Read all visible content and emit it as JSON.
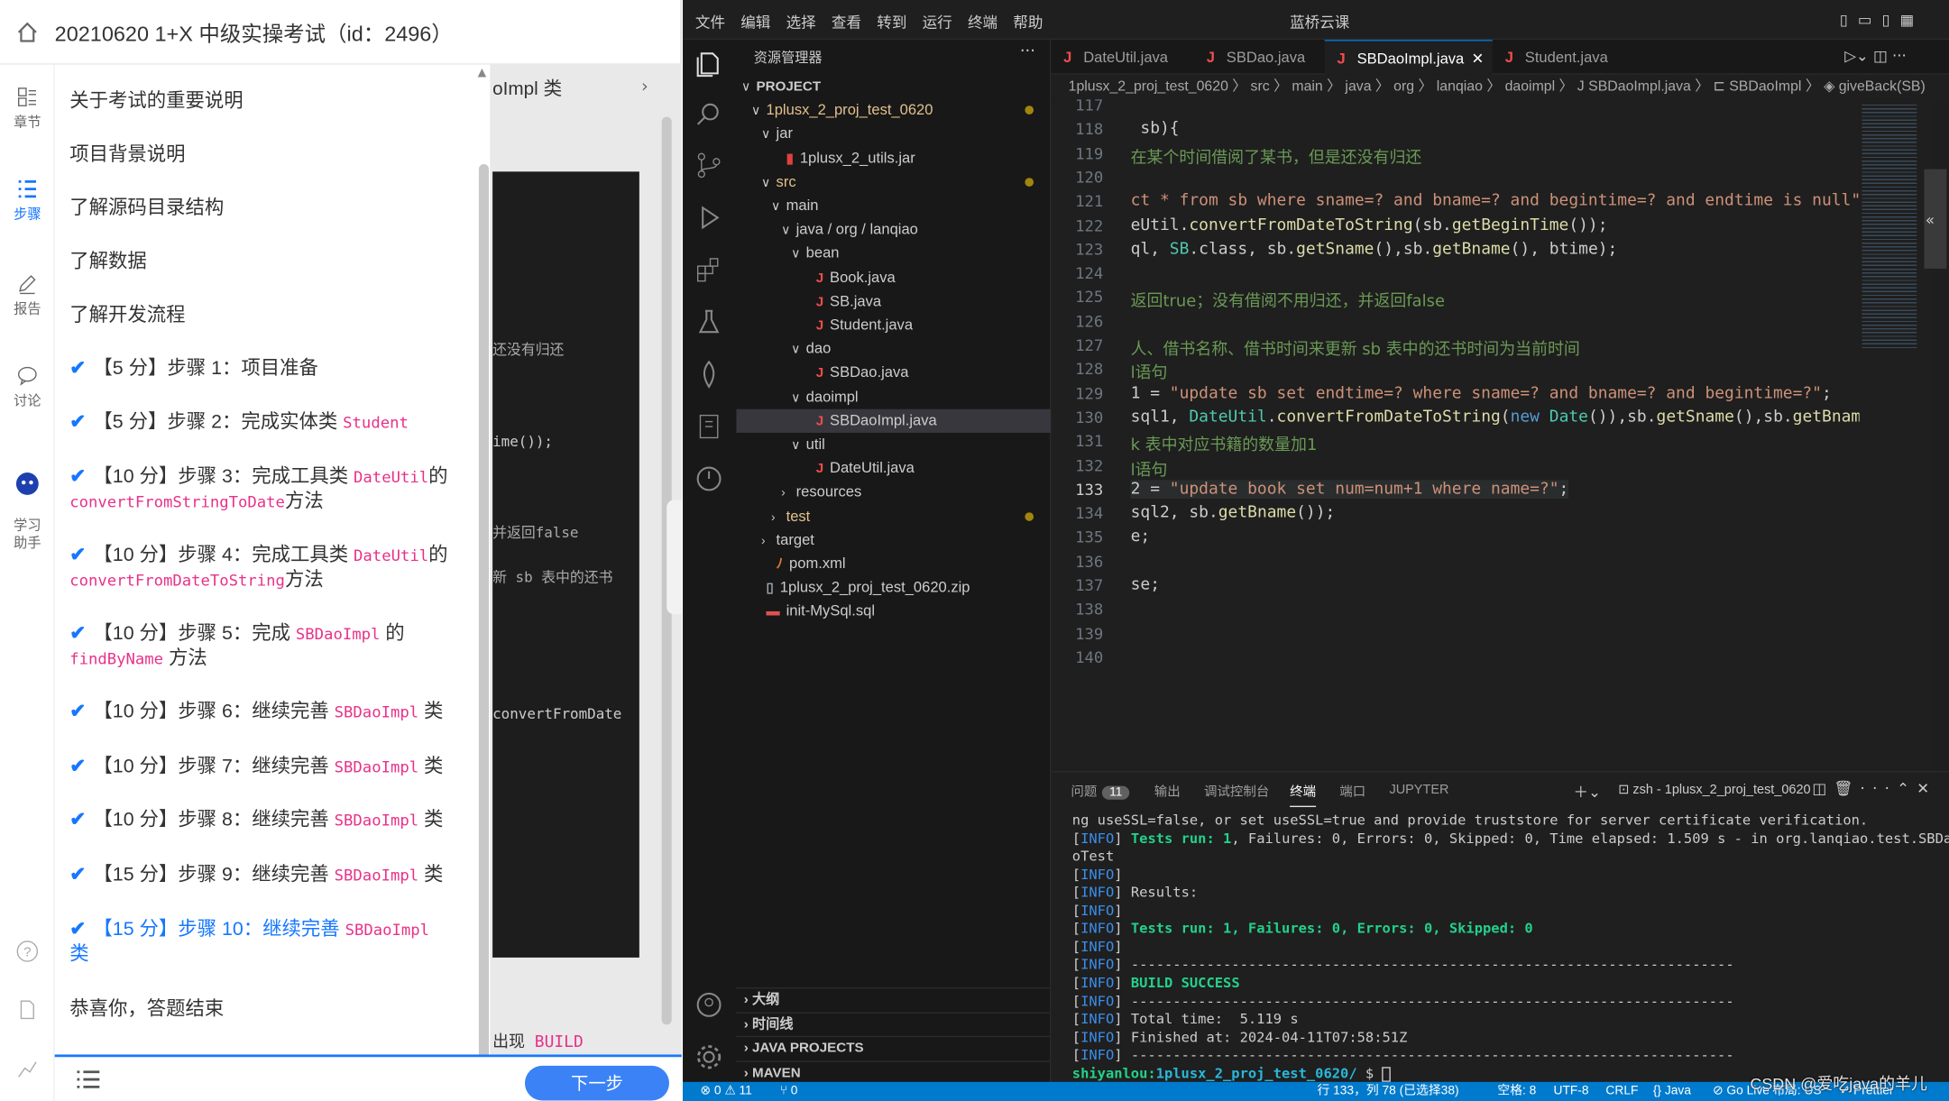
{
  "exam": {
    "title": "20210620 1+X 中级实操考试（id：2496）",
    "rail": [
      "章节",
      "步骤",
      "报告",
      "讨论",
      "学习\n助手"
    ],
    "steps": [
      {
        "text": "关于考试的重要说明"
      },
      {
        "text": "项目背景说明"
      },
      {
        "text": "了解源码目录结构"
      },
      {
        "text": "了解数据"
      },
      {
        "text": "了解开发流程"
      },
      {
        "pre": "【5 分】步骤 1：项目准备",
        "code": "",
        "post": "",
        "done": true
      },
      {
        "pre": "【5 分】步骤 2：完成实体类 ",
        "code": "Student",
        "post": "",
        "done": true
      },
      {
        "pre": "【10 分】步骤 3：完成工具类 ",
        "code": "DateUtil",
        "post": "的",
        "line2code": "convertFromStringToDate",
        "line2post": "方法",
        "done": true
      },
      {
        "pre": "【10 分】步骤 4：完成工具类 ",
        "code": "DateUtil",
        "post": "的",
        "line2code": "convertFromDateToString",
        "line2post": "方法",
        "done": true
      },
      {
        "pre": "【10 分】步骤 5：完成 ",
        "code": "SBDaoImpl",
        "post": " 的",
        "line2code": "findByName",
        "line2post": " 方法",
        "done": true
      },
      {
        "pre": "【10 分】步骤 6：继续完善 ",
        "code": "SBDaoImpl",
        "post": " 类",
        "done": true
      },
      {
        "pre": "【10 分】步骤 7：继续完善 ",
        "code": "SBDaoImpl",
        "post": " 类",
        "done": true
      },
      {
        "pre": "【10 分】步骤 8：继续完善 ",
        "code": "SBDaoImpl",
        "post": " 类",
        "done": true
      },
      {
        "pre": "【15 分】步骤 9：继续完善 ",
        "code": "SBDaoImpl",
        "post": " 类",
        "done": true
      },
      {
        "pre": "【15 分】步骤 10：继续完善 ",
        "code": "SBDaoImpl",
        "post": "",
        "line2post": "类",
        "done": true,
        "current": true
      },
      {
        "text": "恭喜你，答题结束"
      }
    ],
    "under_texts": [
      "oImpl 类",
      "还没有归还",
      "ime());",
      "并返回false",
      "新 sb 表中的还书",
      "convertFromDate",
      "出现 ",
      "BUILD"
    ],
    "next_button": "下一步"
  },
  "vscode": {
    "menu": [
      "文件",
      "编辑",
      "选择",
      "查看",
      "转到",
      "运行",
      "终端",
      "帮助"
    ],
    "window_title": "蓝桥云课",
    "explorer_title": "资源管理器",
    "tree": [
      {
        "label": "PROJECT",
        "depth": 0,
        "chev": "∨",
        "bold": true
      },
      {
        "label": "1plusx_2_proj_test_0620",
        "depth": 1,
        "chev": "∨",
        "mod": true,
        "color": "#e2c08d"
      },
      {
        "label": "jar",
        "depth": 2,
        "chev": "∨"
      },
      {
        "label": "1plusx_2_utils.jar",
        "depth": 3,
        "icon": "jar"
      },
      {
        "label": "src",
        "depth": 2,
        "chev": "∨",
        "mod": true,
        "color": "#e2c08d"
      },
      {
        "label": "main",
        "depth": 3,
        "chev": "∨"
      },
      {
        "label": "java / org / lanqiao",
        "depth": 4,
        "chev": "∨"
      },
      {
        "label": "bean",
        "depth": 5,
        "chev": "∨"
      },
      {
        "label": "Book.java",
        "depth": 6,
        "icon": "J"
      },
      {
        "label": "SB.java",
        "depth": 6,
        "icon": "J"
      },
      {
        "label": "Student.java",
        "depth": 6,
        "icon": "J"
      },
      {
        "label": "dao",
        "depth": 5,
        "chev": "∨"
      },
      {
        "label": "SBDao.java",
        "depth": 6,
        "icon": "J"
      },
      {
        "label": "daoimpl",
        "depth": 5,
        "chev": "∨"
      },
      {
        "label": "SBDaoImpl.java",
        "depth": 6,
        "icon": "J",
        "selected": true
      },
      {
        "label": "util",
        "depth": 5,
        "chev": "∨"
      },
      {
        "label": "DateUtil.java",
        "depth": 6,
        "icon": "J"
      },
      {
        "label": "resources",
        "depth": 4,
        "chev": "›"
      },
      {
        "label": "test",
        "depth": 3,
        "chev": "›",
        "mod": true,
        "color": "#e2c08d"
      },
      {
        "label": "target",
        "depth": 2,
        "chev": "›"
      },
      {
        "label": "pom.xml",
        "depth": 2,
        "icon": "rss"
      },
      {
        "label": "1plusx_2_proj_test_0620.zip",
        "depth": 1,
        "icon": "zip"
      },
      {
        "label": "init-MySql.sql",
        "depth": 1,
        "icon": "sql"
      }
    ],
    "sections": [
      "大纲",
      "时间线",
      "JAVA PROJECTS",
      "MAVEN"
    ],
    "tabs": [
      "DateUtil.java",
      "SBDao.java",
      "SBDaoImpl.java",
      "Student.java"
    ],
    "breadcrumb": "1plusx_2_proj_test_0620 〉 src 〉 main 〉 java 〉 org 〉 lanqiao 〉 daoimpl 〉 J SBDaoImpl.java 〉 ⊏ SBDaoImpl 〉 ◈ giveBack(SB)",
    "code_lines": [
      {
        "n": "117",
        "t": ""
      },
      {
        "n": "118",
        "t": " sb){"
      },
      {
        "n": "119",
        "t": "在某个时间借阅了某书，但是还没有归还",
        "cls": "cm"
      },
      {
        "n": "120",
        "t": ""
      },
      {
        "n": "121",
        "t": "ct * from sb where sname=? and bname=? and begintime=? and endtime is null\";",
        "cls": "str"
      },
      {
        "n": "122",
        "t": "eUtil.convertFromDateToString(sb.getBeginTime());"
      },
      {
        "n": "123",
        "t": "ql, SB.class, sb.getSname(),sb.getBname(), btime);"
      },
      {
        "n": "124",
        "t": ""
      },
      {
        "n": "125",
        "t": "返回true；没有借阅不用归还，并返回false",
        "cls": "cm"
      },
      {
        "n": "126",
        "t": ""
      },
      {
        "n": "127",
        "t": "人、借书名称、借书时间来更新 sb 表中的还书时间为当前时间",
        "cls": "cm"
      },
      {
        "n": "128",
        "t": "l语句",
        "cls": "cm"
      },
      {
        "n": "129",
        "t": "1 = \"update sb set endtime=? where sname=? and bname=? and begintime=?\";"
      },
      {
        "n": "130",
        "t": "sql1, DateUtil.convertFromDateToString(new Date()),sb.getSname(),sb.getBname"
      },
      {
        "n": "131",
        "t": "k 表中对应书籍的数量加1",
        "cls": "cm"
      },
      {
        "n": "132",
        "t": "l语句",
        "cls": "cm"
      },
      {
        "n": "133",
        "t": "2 = \"update book set num=num+1 where name=?\";",
        "cur": true
      },
      {
        "n": "134",
        "t": "sql2, sb.getBname());"
      },
      {
        "n": "135",
        "t": "e;"
      },
      {
        "n": "136",
        "t": ""
      },
      {
        "n": "137",
        "t": "se;"
      },
      {
        "n": "138",
        "t": ""
      },
      {
        "n": "139",
        "t": ""
      },
      {
        "n": "140",
        "t": ""
      }
    ],
    "panel_tabs": [
      "问题",
      "输出",
      "调试控制台",
      "终端",
      "端口",
      "JUPYTER"
    ],
    "problems_count": "11",
    "terminal_name": "zsh - 1plusx_2_proj_test_0620",
    "terminal": [
      "ng useSSL=false, or set useSSL=true and provide truststore for server certificate verification.",
      "[INFO] Tests run: 1, Failures: 0, Errors: 0, Skipped: 0, Time elapsed: 1.509 s - in org.lanqiao.test.SBDa",
      "oTest",
      "[INFO]",
      "[INFO] Results:",
      "[INFO]",
      "[INFO] Tests run: 1, Failures: 0, Errors: 0, Skipped: 0",
      "[INFO]",
      "[INFO] ------------------------------------------------------------------------",
      "[INFO] BUILD SUCCESS",
      "[INFO] ------------------------------------------------------------------------",
      "[INFO] Total time:  5.119 s",
      "[INFO] Finished at: 2024-04-11T07:58:51Z",
      "[INFO] ------------------------------------------------------------------------",
      "shiyanlou:1plusx_2_proj_test_0620/ $ "
    ],
    "status": {
      "errors": "⊗ 0 ⚠ 11",
      "ports": "⑂ 0",
      "position": "行 133，列 78 (已选择38)",
      "spaces": "空格: 8",
      "encoding": "UTF-8",
      "eol": "CRLF",
      "lang": "{} Java",
      "golive": "⊘ Go Live",
      "layout": "布局: US",
      "prettier": "✓ Prettier"
    },
    "watermark": "CSDN @爱吃java的羊儿"
  }
}
